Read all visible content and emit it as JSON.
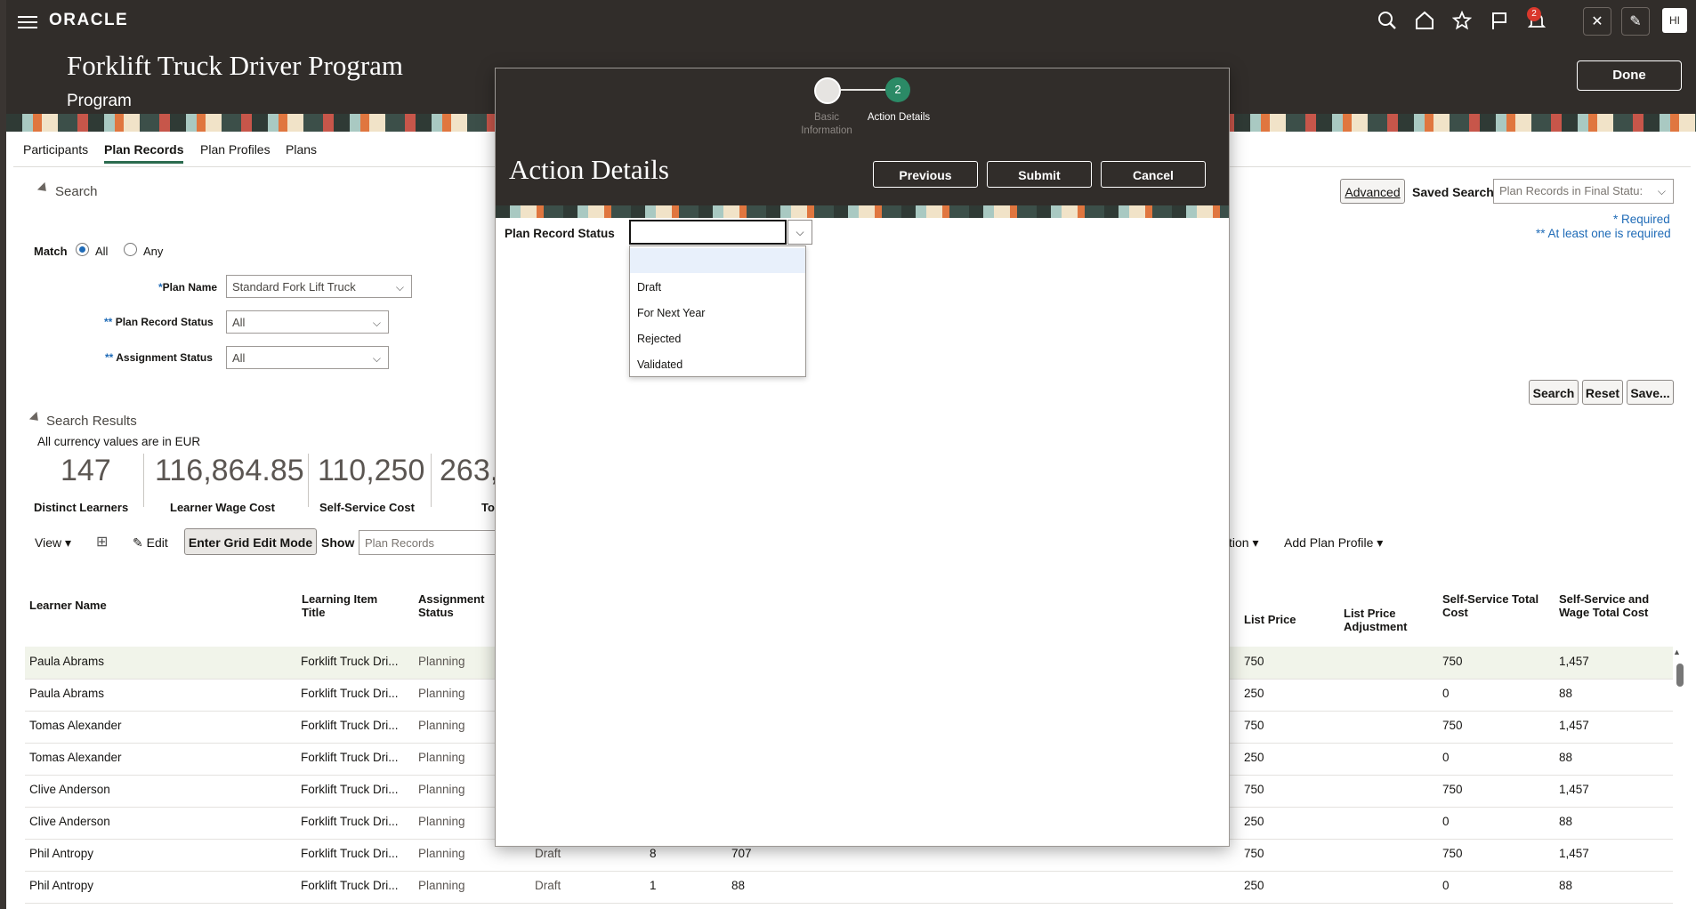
{
  "topbar": {
    "logo": "ORACLE",
    "notifications_count": "2",
    "avatar_initials": "HI"
  },
  "page": {
    "title": "Forklift Truck Driver Program",
    "subtitle": "Program",
    "done_label": "Done"
  },
  "tabs": [
    "Participants",
    "Plan Records",
    "Plan Profiles",
    "Plans"
  ],
  "search": {
    "section_label": "Search",
    "match_label": "Match",
    "match_all": "All",
    "match_any": "Any",
    "plan_name_label": "Plan Name",
    "plan_name_value": "Standard Fork Lift Truck",
    "plan_record_status_label": "Plan Record Status",
    "plan_record_status_value": "All",
    "assignment_status_label": "Assignment Status",
    "assignment_status_value": "All",
    "advanced_label": "Advanced",
    "saved_search_label": "Saved Search",
    "saved_search_value": "Plan Records in Final Statu:",
    "required_note": "Required",
    "at_least_one_note": "At least one is required",
    "search_btn": "Search",
    "reset_btn": "Reset",
    "save_btn": "Save..."
  },
  "results": {
    "section_label": "Search Results",
    "currency_note": "All currency values are in EUR",
    "metrics": [
      {
        "value": "147",
        "label": "Distinct Learners"
      },
      {
        "value": "116,864.85",
        "label": "Learner Wage Cost"
      },
      {
        "value": "110,250",
        "label": "Self-Service Cost"
      },
      {
        "value": "263,",
        "label": "To"
      }
    ]
  },
  "toolbar": {
    "view_label": "View",
    "edit_label": "Edit",
    "grid_edit_label": "Enter Grid Edit Mode",
    "show_label": "Show",
    "show_value": "Plan Records",
    "action_partial": "tion",
    "add_plan_profile": "Add Plan Profile"
  },
  "table": {
    "headers": {
      "learner_name": "Learner Name",
      "learning_item_title": "Learning Item Title",
      "assignment_status": "Assignment Status",
      "list_price": "List Price",
      "list_price_adjustment": "List Price Adjustment",
      "self_service_total_cost": "Self-Service Total Cost",
      "self_service_wage_total_cost": "Self-Service and Wage Total Cost"
    },
    "rows": [
      {
        "name": "Paula Abrams",
        "item": "Forklift Truck Dri...",
        "assign": "Planning",
        "status": "",
        "c1": "",
        "c2": "",
        "list_price": "750",
        "ss_total": "750",
        "ss_wage": "1,457"
      },
      {
        "name": "Paula Abrams",
        "item": "Forklift Truck Dri...",
        "assign": "Planning",
        "status": "",
        "c1": "",
        "c2": "",
        "list_price": "250",
        "ss_total": "0",
        "ss_wage": "88"
      },
      {
        "name": "Tomas Alexander",
        "item": "Forklift Truck Dri...",
        "assign": "Planning",
        "status": "",
        "c1": "",
        "c2": "",
        "list_price": "750",
        "ss_total": "750",
        "ss_wage": "1,457"
      },
      {
        "name": "Tomas Alexander",
        "item": "Forklift Truck Dri...",
        "assign": "Planning",
        "status": "",
        "c1": "",
        "c2": "",
        "list_price": "250",
        "ss_total": "0",
        "ss_wage": "88"
      },
      {
        "name": "Clive Anderson",
        "item": "Forklift Truck Dri...",
        "assign": "Planning",
        "status": "",
        "c1": "",
        "c2": "",
        "list_price": "750",
        "ss_total": "750",
        "ss_wage": "1,457"
      },
      {
        "name": "Clive Anderson",
        "item": "Forklift Truck Dri...",
        "assign": "Planning",
        "status": "",
        "c1": "",
        "c2": "",
        "list_price": "250",
        "ss_total": "0",
        "ss_wage": "88"
      },
      {
        "name": "Phil Antropy",
        "item": "Forklift Truck Dri...",
        "assign": "Planning",
        "status": "Draft",
        "c1": "8",
        "c2": "707",
        "list_price": "750",
        "ss_total": "750",
        "ss_wage": "1,457"
      },
      {
        "name": "Phil Antropy",
        "item": "Forklift Truck Dri...",
        "assign": "Planning",
        "status": "Draft",
        "c1": "1",
        "c2": "88",
        "list_price": "250",
        "ss_total": "0",
        "ss_wage": "88"
      }
    ]
  },
  "modal": {
    "step1_label_line1": "Basic",
    "step1_label_line2": "Information",
    "step2_number": "2",
    "step2_label": "Action Details",
    "title": "Action Details",
    "previous_btn": "Previous",
    "submit_btn": "Submit",
    "cancel_btn": "Cancel",
    "field_label": "Plan Record Status",
    "field_value": "",
    "dropdown_options": [
      "",
      "Draft",
      "For Next Year",
      "Rejected",
      "Validated"
    ]
  }
}
